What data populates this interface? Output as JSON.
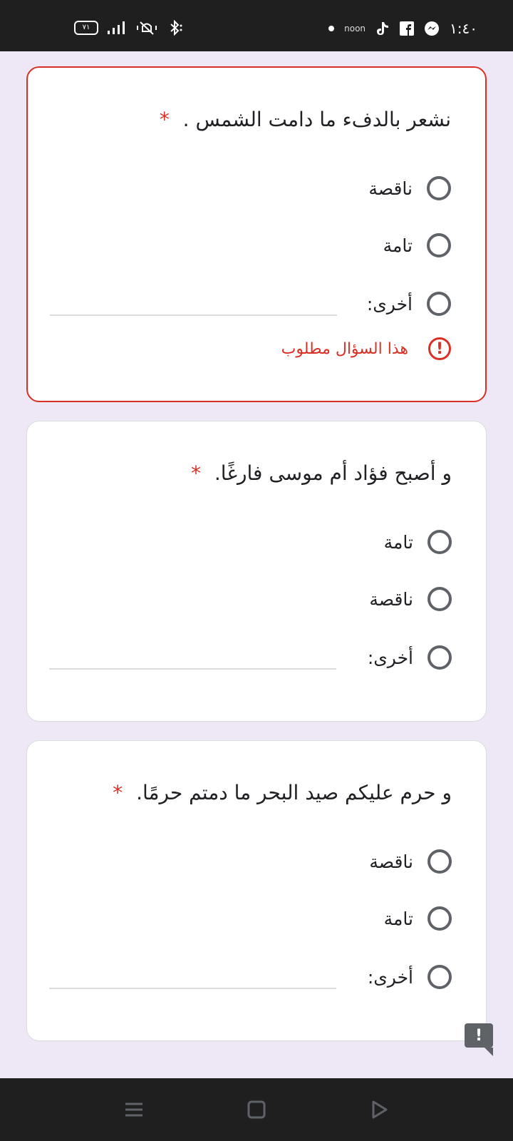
{
  "status_bar": {
    "time": "١:٤٠",
    "battery": "٧١",
    "noon_label": "noon"
  },
  "questions": [
    {
      "text": "نشعر بالدفء ما دامت الشمس .",
      "required_mark": "*",
      "options": [
        "ناقصة",
        "تامة"
      ],
      "other_label": "أخرى:",
      "error": "هذا السؤال مطلوب"
    },
    {
      "text": "و أصبح فؤاد أم موسى فارغًا.",
      "required_mark": "*",
      "options": [
        "تامة",
        "ناقصة"
      ],
      "other_label": "أخرى:"
    },
    {
      "text": "و حرم عليكم صيد البحر ما دمتم حرمًا.",
      "required_mark": "*",
      "options": [
        "ناقصة",
        "تامة"
      ],
      "other_label": "أخرى:"
    }
  ],
  "feedback_icon": "exclamation-icon",
  "nav_icons": [
    "menu-icon",
    "home-square-icon",
    "back-triangle-icon"
  ]
}
